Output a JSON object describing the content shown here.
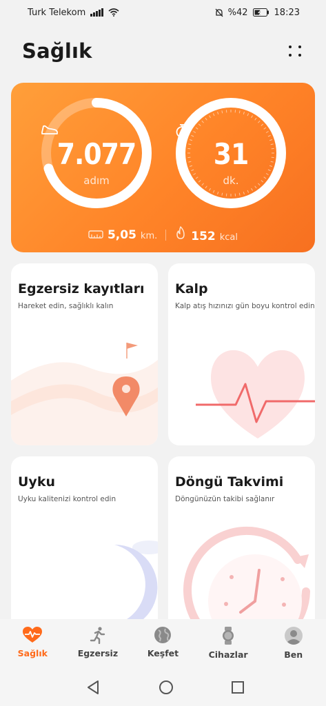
{
  "status_bar": {
    "carrier": "Turk Telekom",
    "battery": "%42",
    "time": "18:23"
  },
  "header": {
    "title": "Sağlık"
  },
  "summary": {
    "steps": {
      "value": "7.077",
      "unit": "adım",
      "progress": 0.7
    },
    "duration": {
      "value": "31",
      "unit": "dk.",
      "progress": 1.0
    },
    "distance": {
      "value": "5,05",
      "unit": "km."
    },
    "calories": {
      "value": "152",
      "unit": "kcal"
    }
  },
  "tiles": [
    {
      "title": "Egzersiz kayıtları",
      "subtitle": "Hareket edin, sağlıklı kalın"
    },
    {
      "title": "Kalp",
      "subtitle": "Kalp atış hızınızı gün boyu kontrol edin"
    },
    {
      "title": "Uyku",
      "subtitle": "Uyku kalitenizi kontrol edin"
    },
    {
      "title": "Döngü Takvimi",
      "subtitle": "Döngünüzün takibi sağlanır"
    }
  ],
  "bottom_nav": [
    {
      "label": "Sağlık",
      "icon": "heart-pulse-icon",
      "active": true
    },
    {
      "label": "Egzersiz",
      "icon": "running-icon",
      "active": false
    },
    {
      "label": "Keşfet",
      "icon": "globe-icon",
      "active": false
    },
    {
      "label": "Cihazlar",
      "icon": "watch-icon",
      "active": false
    },
    {
      "label": "Ben",
      "icon": "person-icon",
      "active": false
    }
  ],
  "colors": {
    "accent": "#ff6a1a",
    "card_gradient_start": "#ff9f3a",
    "card_gradient_end": "#f77020"
  }
}
